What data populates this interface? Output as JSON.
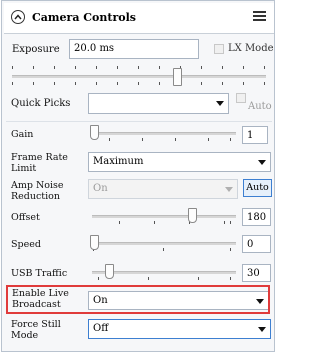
{
  "header": {
    "title": "Camera Controls"
  },
  "exposure": {
    "label": "Exposure",
    "value": "20.0 ms",
    "lx_mode_label": "LX Mode"
  },
  "quick_picks": {
    "label": "Quick Picks",
    "value": "",
    "auto_label": "Auto"
  },
  "gain": {
    "label": "Gain",
    "value": "1",
    "level": 0
  },
  "frame_rate": {
    "label": "Frame Rate Limit",
    "value": "Maximum"
  },
  "amp_noise": {
    "label": "Amp Noise Reduction",
    "value": "On",
    "button": "Auto"
  },
  "offset": {
    "label": "Offset",
    "value": "180"
  },
  "speed": {
    "label": "Speed",
    "value": "0",
    "level": 0
  },
  "usb_traffic": {
    "label": "USB Traffic",
    "value": "30"
  },
  "live_broadcast": {
    "label": "Enable Live Broadcast",
    "value": "On"
  },
  "force_still": {
    "label": "Force Still Mode",
    "value": "Off"
  },
  "colors": {
    "highlight": "#e03b3b",
    "accent": "#3d7fd1",
    "border": "#a9b4c2"
  }
}
